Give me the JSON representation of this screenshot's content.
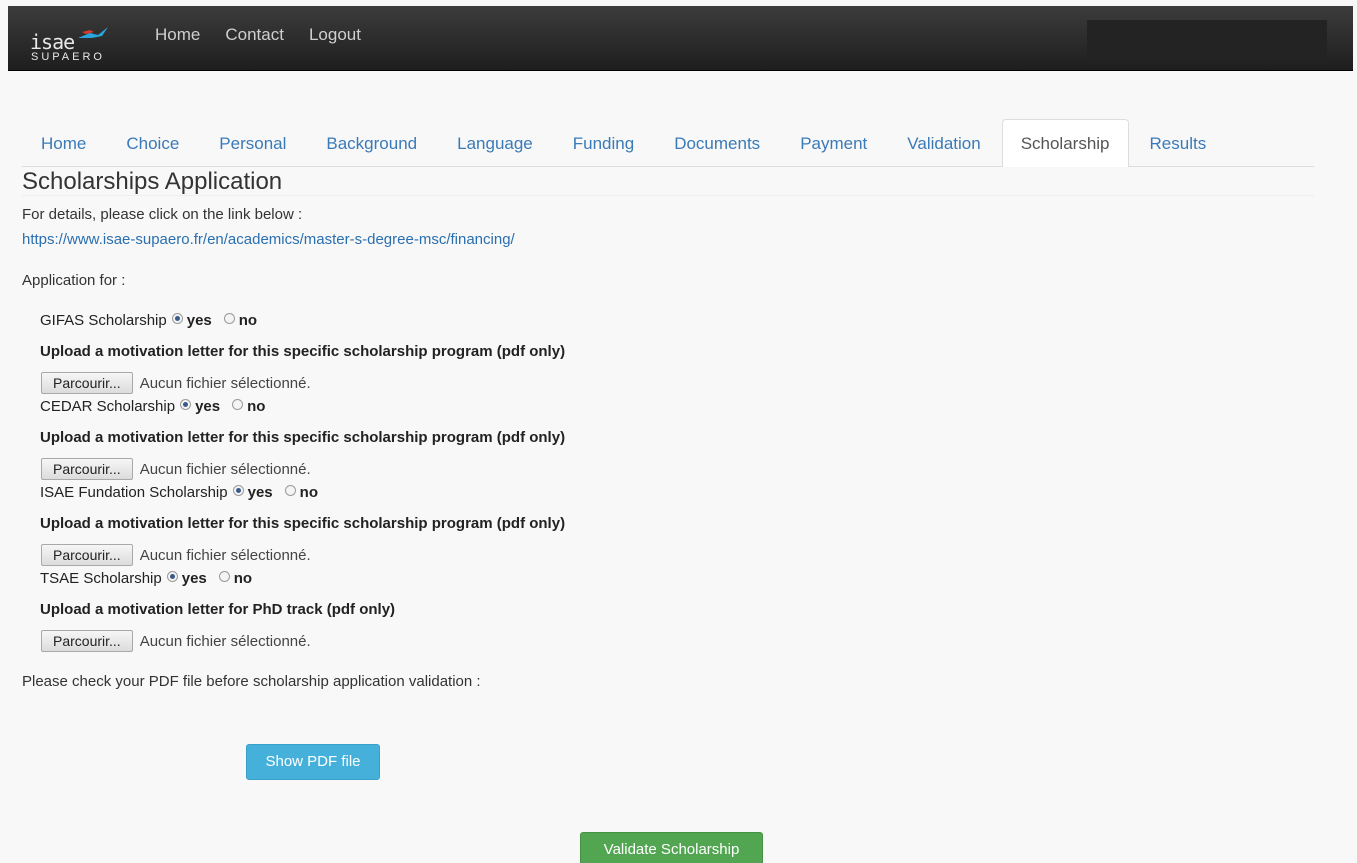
{
  "navbar": {
    "logo": {
      "top": "isae",
      "bottom": "SUPAERO"
    },
    "links": [
      "Home",
      "Contact",
      "Logout"
    ]
  },
  "tabs": [
    {
      "label": "Home",
      "active": false
    },
    {
      "label": "Choice",
      "active": false
    },
    {
      "label": "Personal",
      "active": false
    },
    {
      "label": "Background",
      "active": false
    },
    {
      "label": "Language",
      "active": false
    },
    {
      "label": "Funding",
      "active": false
    },
    {
      "label": "Documents",
      "active": false
    },
    {
      "label": "Payment",
      "active": false
    },
    {
      "label": "Validation",
      "active": false
    },
    {
      "label": "Scholarship",
      "active": true
    },
    {
      "label": "Results",
      "active": false
    }
  ],
  "main": {
    "title": "Scholarships Application",
    "details_text": "For details, please click on the link below :",
    "details_link": "https://www.isae-supaero.fr/en/academics/master-s-degree-msc/financing/",
    "application_for": "Application for :",
    "scholarships": [
      {
        "name": "GIFAS Scholarship",
        "yes": "yes",
        "no": "no",
        "selected": "yes",
        "upload_label": "Upload a motivation letter for this specific scholarship program (pdf only)",
        "browse": "Parcourir...",
        "file_status": "Aucun fichier sélectionné."
      },
      {
        "name": "CEDAR Scholarship",
        "yes": "yes",
        "no": "no",
        "selected": "yes",
        "upload_label": "Upload a motivation letter for this specific scholarship program (pdf only)",
        "browse": "Parcourir...",
        "file_status": "Aucun fichier sélectionné."
      },
      {
        "name": "ISAE Fundation Scholarship",
        "yes": "yes",
        "no": "no",
        "selected": "yes",
        "upload_label": "Upload a motivation letter for this specific scholarship program (pdf only)",
        "browse": "Parcourir...",
        "file_status": "Aucun fichier sélectionné."
      },
      {
        "name": "TSAE Scholarship",
        "yes": "yes",
        "no": "no",
        "selected": "yes",
        "upload_label": "Upload a motivation letter for PhD track (pdf only)",
        "browse": "Parcourir...",
        "file_status": "Aucun fichier sélectionné."
      }
    ],
    "check_text": "Please check your PDF file before scholarship application validation :",
    "show_pdf_button": "Show PDF file",
    "validate_button": "Validate Scholarship"
  },
  "colors": {
    "navbar": "#2b2b2b",
    "link": "#3a7ab7",
    "show_pdf": "#45b1db",
    "validate": "#52a651"
  }
}
